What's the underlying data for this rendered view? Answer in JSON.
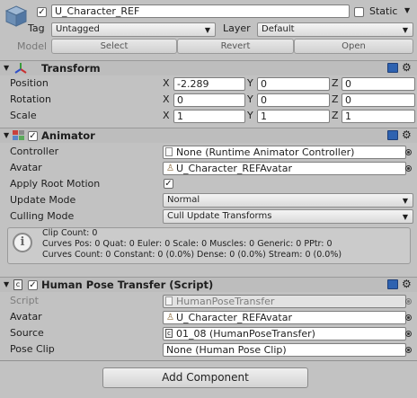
{
  "object": {
    "active": true,
    "name": "U_Character_REF",
    "static_label": "Static",
    "static": false,
    "tag_label": "Tag",
    "tag_value": "Untagged",
    "layer_label": "Layer",
    "layer_value": "Default",
    "model_label": "Model",
    "model_buttons": [
      "Select",
      "Revert",
      "Open"
    ]
  },
  "transform": {
    "title": "Transform",
    "rows": [
      {
        "label": "Position",
        "x": "-2.289",
        "y": "0",
        "z": "0"
      },
      {
        "label": "Rotation",
        "x": "0",
        "y": "0",
        "z": "0"
      },
      {
        "label": "Scale",
        "x": "1",
        "y": "1",
        "z": "1"
      }
    ],
    "axes": [
      "X",
      "Y",
      "Z"
    ]
  },
  "animator": {
    "title": "Animator",
    "enabled": true,
    "controller_label": "Controller",
    "controller_value": "None (Runtime Animator Controller)",
    "avatar_label": "Avatar",
    "avatar_value": "U_Character_REFAvatar",
    "apply_root_motion_label": "Apply Root Motion",
    "apply_root_motion": true,
    "update_mode_label": "Update Mode",
    "update_mode_value": "Normal",
    "culling_mode_label": "Culling Mode",
    "culling_mode_value": "Cull Update Transforms",
    "info_lines": [
      "Clip Count: 0",
      "Curves Pos: 0 Quat: 0 Euler: 0 Scale: 0 Muscles: 0 Generic: 0 PPtr: 0",
      "Curves Count: 0 Constant: 0 (0.0%) Dense: 0 (0.0%) Stream: 0 (0.0%)"
    ]
  },
  "hpt": {
    "title": "Human Pose Transfer (Script)",
    "enabled": true,
    "script_label": "Script",
    "script_value": "HumanPoseTransfer",
    "avatar_label": "Avatar",
    "avatar_value": "U_Character_REFAvatar",
    "source_label": "Source",
    "source_value": "01_08 (HumanPoseTransfer)",
    "pose_clip_label": "Pose Clip",
    "pose_clip_value": "None (Human Pose Clip)"
  },
  "add_component_label": "Add Component"
}
